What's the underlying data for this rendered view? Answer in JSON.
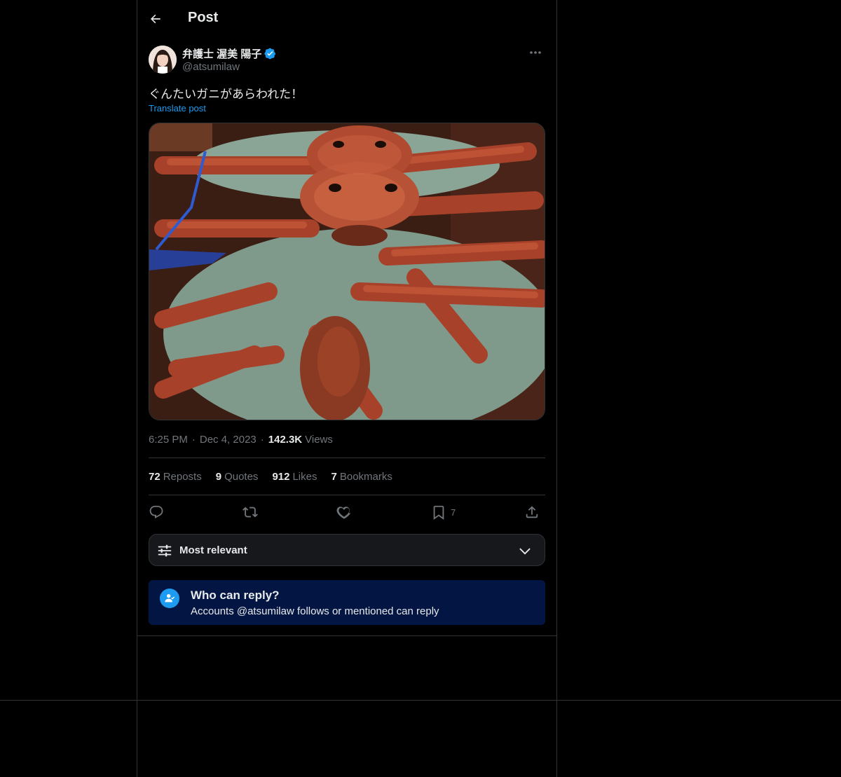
{
  "header": {
    "title": "Post"
  },
  "author": {
    "name": "弁護士 渥美 陽子",
    "handle": "@atsumilaw",
    "verified": true,
    "verified_color": "#1d9bf0"
  },
  "post": {
    "text": "ぐんたいガニがあらわれた！",
    "translate_label": "Translate post",
    "media_description_icon": "crab-photo",
    "time": "6:25 PM",
    "date": "Dec 4, 2023",
    "views_count": "142.3K",
    "views_label": "Views"
  },
  "stats": [
    {
      "count": "72",
      "label": "Reposts"
    },
    {
      "count": "9",
      "label": "Quotes"
    },
    {
      "count": "912",
      "label": "Likes"
    },
    {
      "count": "7",
      "label": "Bookmarks"
    }
  ],
  "actions": {
    "reply_icon": "reply-icon",
    "repost_icon": "repost-icon",
    "like_icon": "heart-icon",
    "bookmark_icon": "bookmark-icon",
    "bookmark_count": "7",
    "share_icon": "share-icon"
  },
  "sort": {
    "label": "Most relevant"
  },
  "reply_restriction": {
    "title": "Who can reply?",
    "subtitle": "Accounts @atsumilaw follows or mentioned can reply"
  },
  "colors": {
    "background": "#000000",
    "accent": "#1d9bf0",
    "muted": "#71767b",
    "notice_bg": "#031643"
  }
}
